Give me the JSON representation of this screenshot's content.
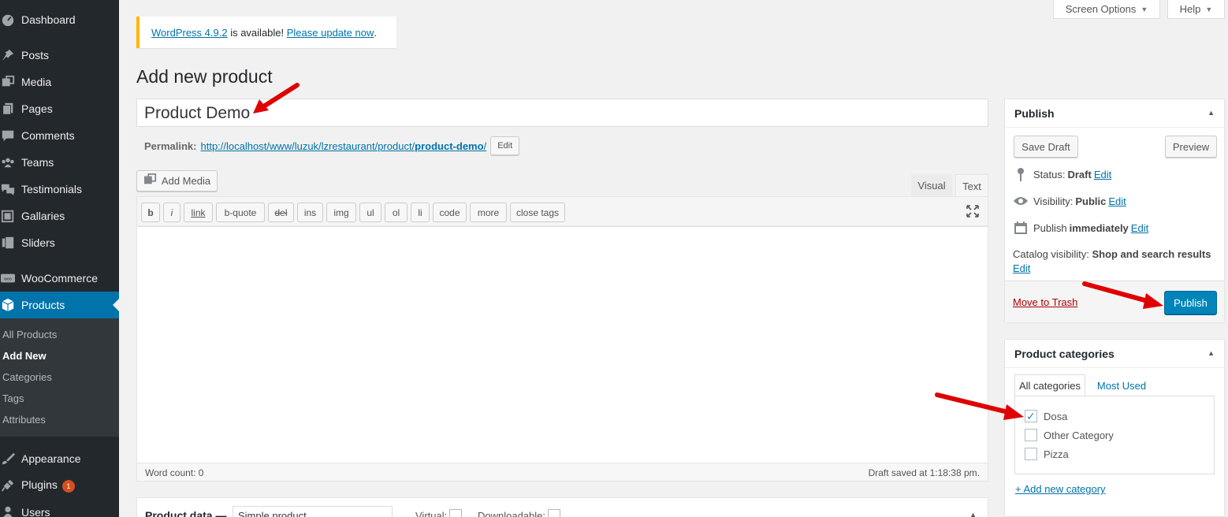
{
  "sidebar": {
    "items": [
      {
        "label": "Dashboard",
        "icon": "dashboard-icon"
      },
      {
        "label": "Posts",
        "icon": "pushpin-icon"
      },
      {
        "label": "Media",
        "icon": "media-icon"
      },
      {
        "label": "Pages",
        "icon": "pages-icon"
      },
      {
        "label": "Comments",
        "icon": "comment-icon"
      },
      {
        "label": "Teams",
        "icon": "groups-icon"
      },
      {
        "label": "Testimonials",
        "icon": "testimonial-icon"
      },
      {
        "label": "Gallaries",
        "icon": "gallery-icon"
      },
      {
        "label": "Sliders",
        "icon": "slides-icon"
      },
      {
        "label": "WooCommerce",
        "icon": "woo-icon"
      },
      {
        "label": "Products",
        "icon": "product-box-icon"
      },
      {
        "label": "Appearance",
        "icon": "brush-icon"
      },
      {
        "label": "Plugins",
        "icon": "plugin-icon",
        "badge": "1"
      },
      {
        "label": "Users",
        "icon": "users-icon"
      }
    ],
    "submenu": [
      "All Products",
      "Add New",
      "Categories",
      "Tags",
      "Attributes"
    ]
  },
  "topbar": {
    "screen_options": "Screen Options",
    "help": "Help"
  },
  "notice": {
    "version_link": "WordPress 4.9.2",
    "middle": " is available! ",
    "update_link": "Please update now",
    "end": "."
  },
  "page_title": "Add new product",
  "title_value": "Product Demo",
  "permalink": {
    "label": "Permalink:",
    "url_base": "http://localhost/www/luzuk/lzrestaurant/product/",
    "slug": "product-demo",
    "url_end": "/",
    "edit": "Edit"
  },
  "editor": {
    "add_media": "Add Media",
    "tabs": {
      "visual": "Visual",
      "text": "Text"
    },
    "quicktags": [
      "b",
      "i",
      "link",
      "b-quote",
      "del",
      "ins",
      "img",
      "ul",
      "ol",
      "li",
      "code",
      "more",
      "close tags"
    ],
    "word_count": "Word count: 0",
    "draft_saved": "Draft saved at 1:18:38 pm."
  },
  "product_data": {
    "title": "Product data —",
    "type": "Simple product",
    "virtual": "Virtual:",
    "downloadable": "Downloadable:"
  },
  "publish": {
    "title": "Publish",
    "save_draft": "Save Draft",
    "preview": "Preview",
    "status_label": "Status:",
    "status_value": "Draft",
    "visibility_label": "Visibility:",
    "visibility_value": "Public",
    "publish_label": "Publish",
    "publish_value": "immediately",
    "catalog_label": "Catalog visibility:",
    "catalog_value": "Shop and search results",
    "edit": "Edit",
    "trash": "Move to Trash",
    "publish_btn": "Publish"
  },
  "categories": {
    "title": "Product categories",
    "tab_all": "All categories",
    "tab_used": "Most Used",
    "items": [
      {
        "label": "Dosa",
        "checked": true
      },
      {
        "label": "Other Category",
        "checked": false
      },
      {
        "label": "Pizza",
        "checked": false
      }
    ],
    "add_new": "+ Add new category"
  },
  "colors": {
    "sidebar": "#23282d",
    "accent": "#0073aa",
    "publish": "#0085ba",
    "notice": "#ffb900",
    "arrow": "#e00000"
  }
}
